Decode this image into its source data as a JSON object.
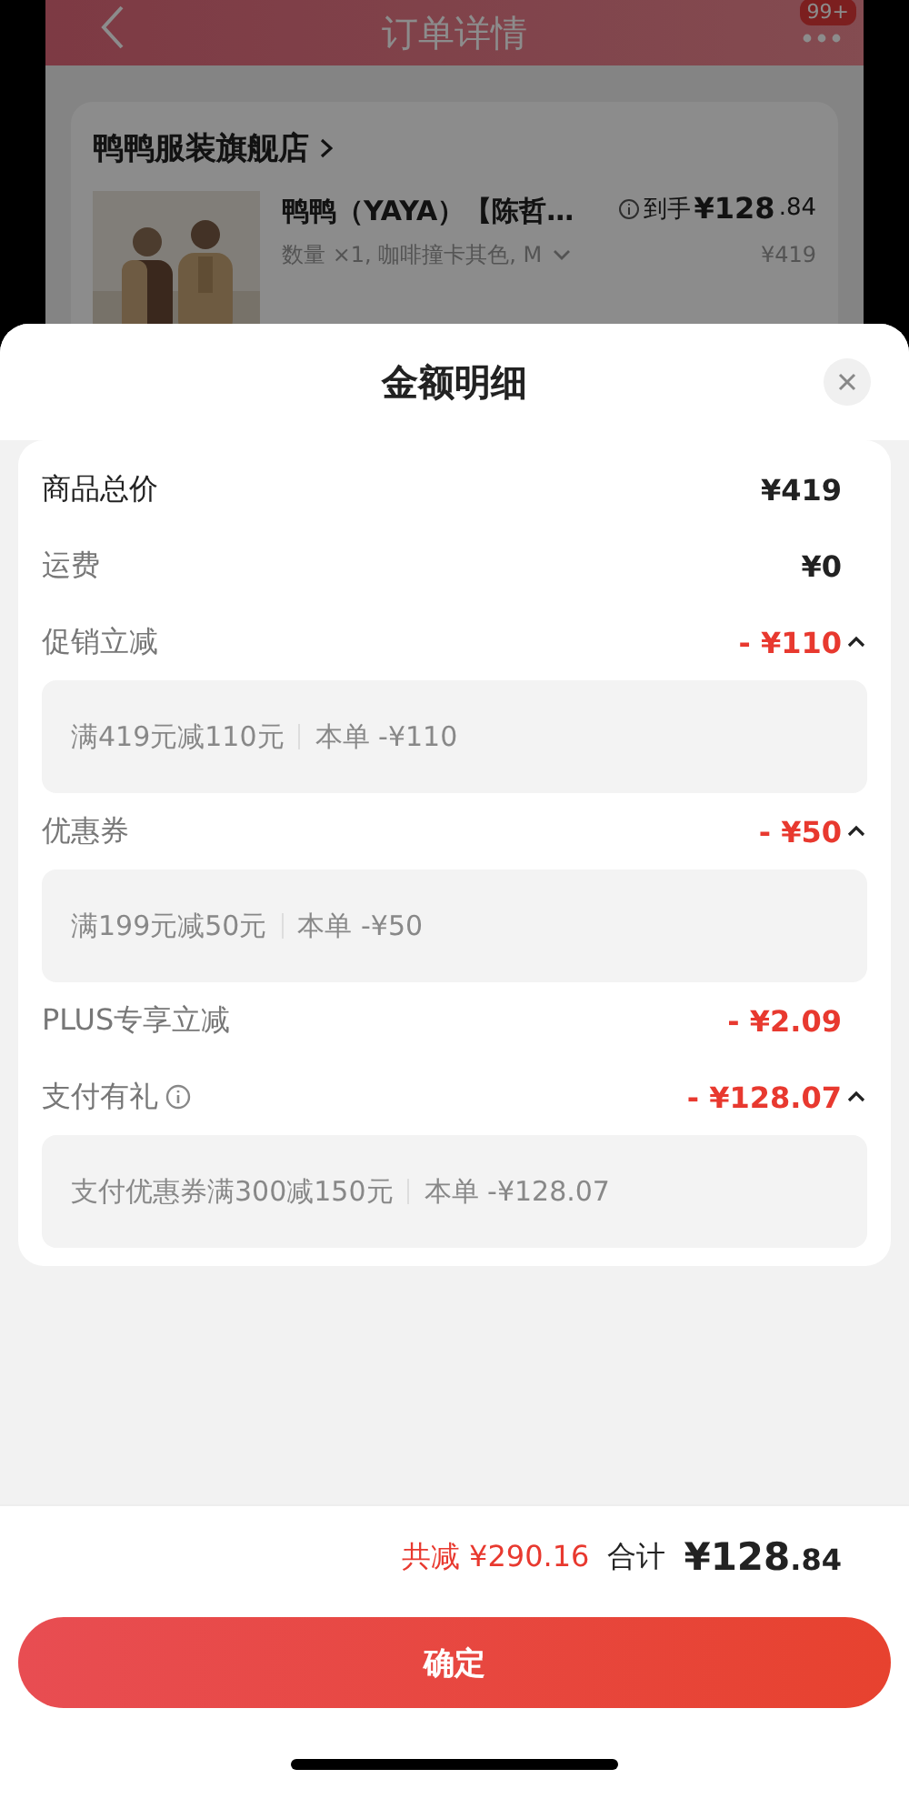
{
  "header": {
    "title": "订单详情",
    "badge": "99+"
  },
  "order": {
    "store": "鸭鸭服装旗舰店",
    "product": {
      "kind": "picture",
      "title": "鸭鸭（YAYA）【陈哲…",
      "sku": "数量 ×1, 咖啡撞卡其色, M",
      "price_label": "到手",
      "price_main": "¥128",
      "price_decimal": ".84",
      "original_price": "¥419"
    }
  },
  "sheet": {
    "title": "金额明细",
    "rows": [
      {
        "kind": "total",
        "label": "商品总价",
        "amount": "¥419"
      },
      {
        "kind": "plain",
        "label": "运费",
        "amount": "¥0"
      },
      {
        "kind": "discount",
        "label": "促销立减",
        "amount": "- ¥110",
        "expanded": true,
        "detail": {
          "condition": "满419元减110元",
          "this_order": "本单 -¥110"
        }
      },
      {
        "kind": "discount",
        "label": "优惠券",
        "amount": "- ¥50",
        "expanded": true,
        "detail": {
          "condition": "满199元减50元",
          "this_order": "本单 -¥50"
        }
      },
      {
        "kind": "discount",
        "label": "PLUS专享立减",
        "amount": "- ¥2.09"
      },
      {
        "kind": "discount",
        "label": "支付有礼",
        "info": true,
        "amount": "- ¥128.07",
        "expanded": true,
        "detail": {
          "condition": "支付优惠券满300减150元",
          "this_order": "本单 -¥128.07"
        }
      }
    ],
    "summary": {
      "saved": "共减 ¥290.16",
      "total_label": "合计",
      "total_main": "¥128",
      "total_decimal": ".84"
    },
    "confirm": "确定"
  }
}
